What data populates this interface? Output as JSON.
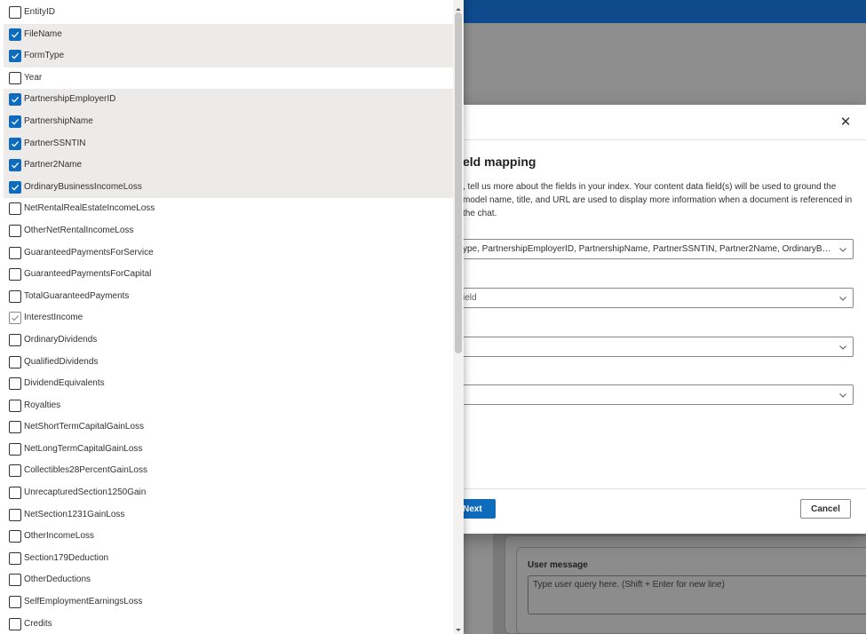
{
  "background": {
    "user_message_label": "User message",
    "user_message_placeholder": "Type user query here. (Shift + Enter for new line)"
  },
  "dialog": {
    "close_label": "✕",
    "title": "eld mapping",
    "description": ", tell us more about the fields in your index. Your content data field(s) will be used to ground the model name, title, and URL are used to display more information when a document is referenced in the chat.",
    "fields": [
      {
        "value": "ype, PartnershipEmployerID, PartnershipName, PartnerSSNTIN, Partner2Name, OrdinaryBusinessIn...",
        "placeholder": false
      },
      {
        "value": "ield",
        "placeholder": true
      },
      {
        "value": "",
        "placeholder": true
      },
      {
        "value": "",
        "placeholder": true
      }
    ],
    "next_label": "Next",
    "cancel_label": "Cancel"
  },
  "field_list": [
    {
      "label": "EntityID",
      "checked": false,
      "selected": false
    },
    {
      "label": "FileName",
      "checked": true,
      "selected": true
    },
    {
      "label": "FormType",
      "checked": true,
      "selected": true
    },
    {
      "label": "Year",
      "checked": false,
      "selected": false
    },
    {
      "label": "PartnershipEmployerID",
      "checked": true,
      "selected": true
    },
    {
      "label": "PartnershipName",
      "checked": true,
      "selected": true
    },
    {
      "label": "PartnerSSNTIN",
      "checked": true,
      "selected": true
    },
    {
      "label": "Partner2Name",
      "checked": true,
      "selected": true
    },
    {
      "label": "OrdinaryBusinessIncomeLoss",
      "checked": true,
      "selected": true
    },
    {
      "label": "NetRentalRealEstateIncomeLoss",
      "checked": false,
      "selected": false
    },
    {
      "label": "OtherNetRentalIncomeLoss",
      "checked": false,
      "selected": false
    },
    {
      "label": "GuaranteedPaymentsForService",
      "checked": false,
      "selected": false
    },
    {
      "label": "GuaranteedPaymentsForCapital",
      "checked": false,
      "selected": false
    },
    {
      "label": "TotalGuaranteedPayments",
      "checked": false,
      "selected": false
    },
    {
      "label": "InterestIncome",
      "checked": false,
      "selected": false,
      "faint": true
    },
    {
      "label": "OrdinaryDividends",
      "checked": false,
      "selected": false
    },
    {
      "label": "QualifiedDividends",
      "checked": false,
      "selected": false
    },
    {
      "label": "DividendEquivalents",
      "checked": false,
      "selected": false
    },
    {
      "label": "Royalties",
      "checked": false,
      "selected": false
    },
    {
      "label": "NetShortTermCapitalGainLoss",
      "checked": false,
      "selected": false
    },
    {
      "label": "NetLongTermCapitalGainLoss",
      "checked": false,
      "selected": false
    },
    {
      "label": "Collectibles28PercentGainLoss",
      "checked": false,
      "selected": false
    },
    {
      "label": "UnrecapturedSection1250Gain",
      "checked": false,
      "selected": false
    },
    {
      "label": "NetSection1231GainLoss",
      "checked": false,
      "selected": false
    },
    {
      "label": "OtherIncomeLoss",
      "checked": false,
      "selected": false
    },
    {
      "label": "Section179Deduction",
      "checked": false,
      "selected": false
    },
    {
      "label": "OtherDeductions",
      "checked": false,
      "selected": false
    },
    {
      "label": "SelfEmploymentEarningsLoss",
      "checked": false,
      "selected": false
    },
    {
      "label": "Credits",
      "checked": false,
      "selected": false
    }
  ],
  "colors": {
    "accent": "#0f6cbd",
    "topbar": "#0f4a8c",
    "selected_row": "#edebe9"
  },
  "icons": {
    "close": "close-icon",
    "dropdown": "chevron-down-icon",
    "check": "checkmark-icon"
  }
}
